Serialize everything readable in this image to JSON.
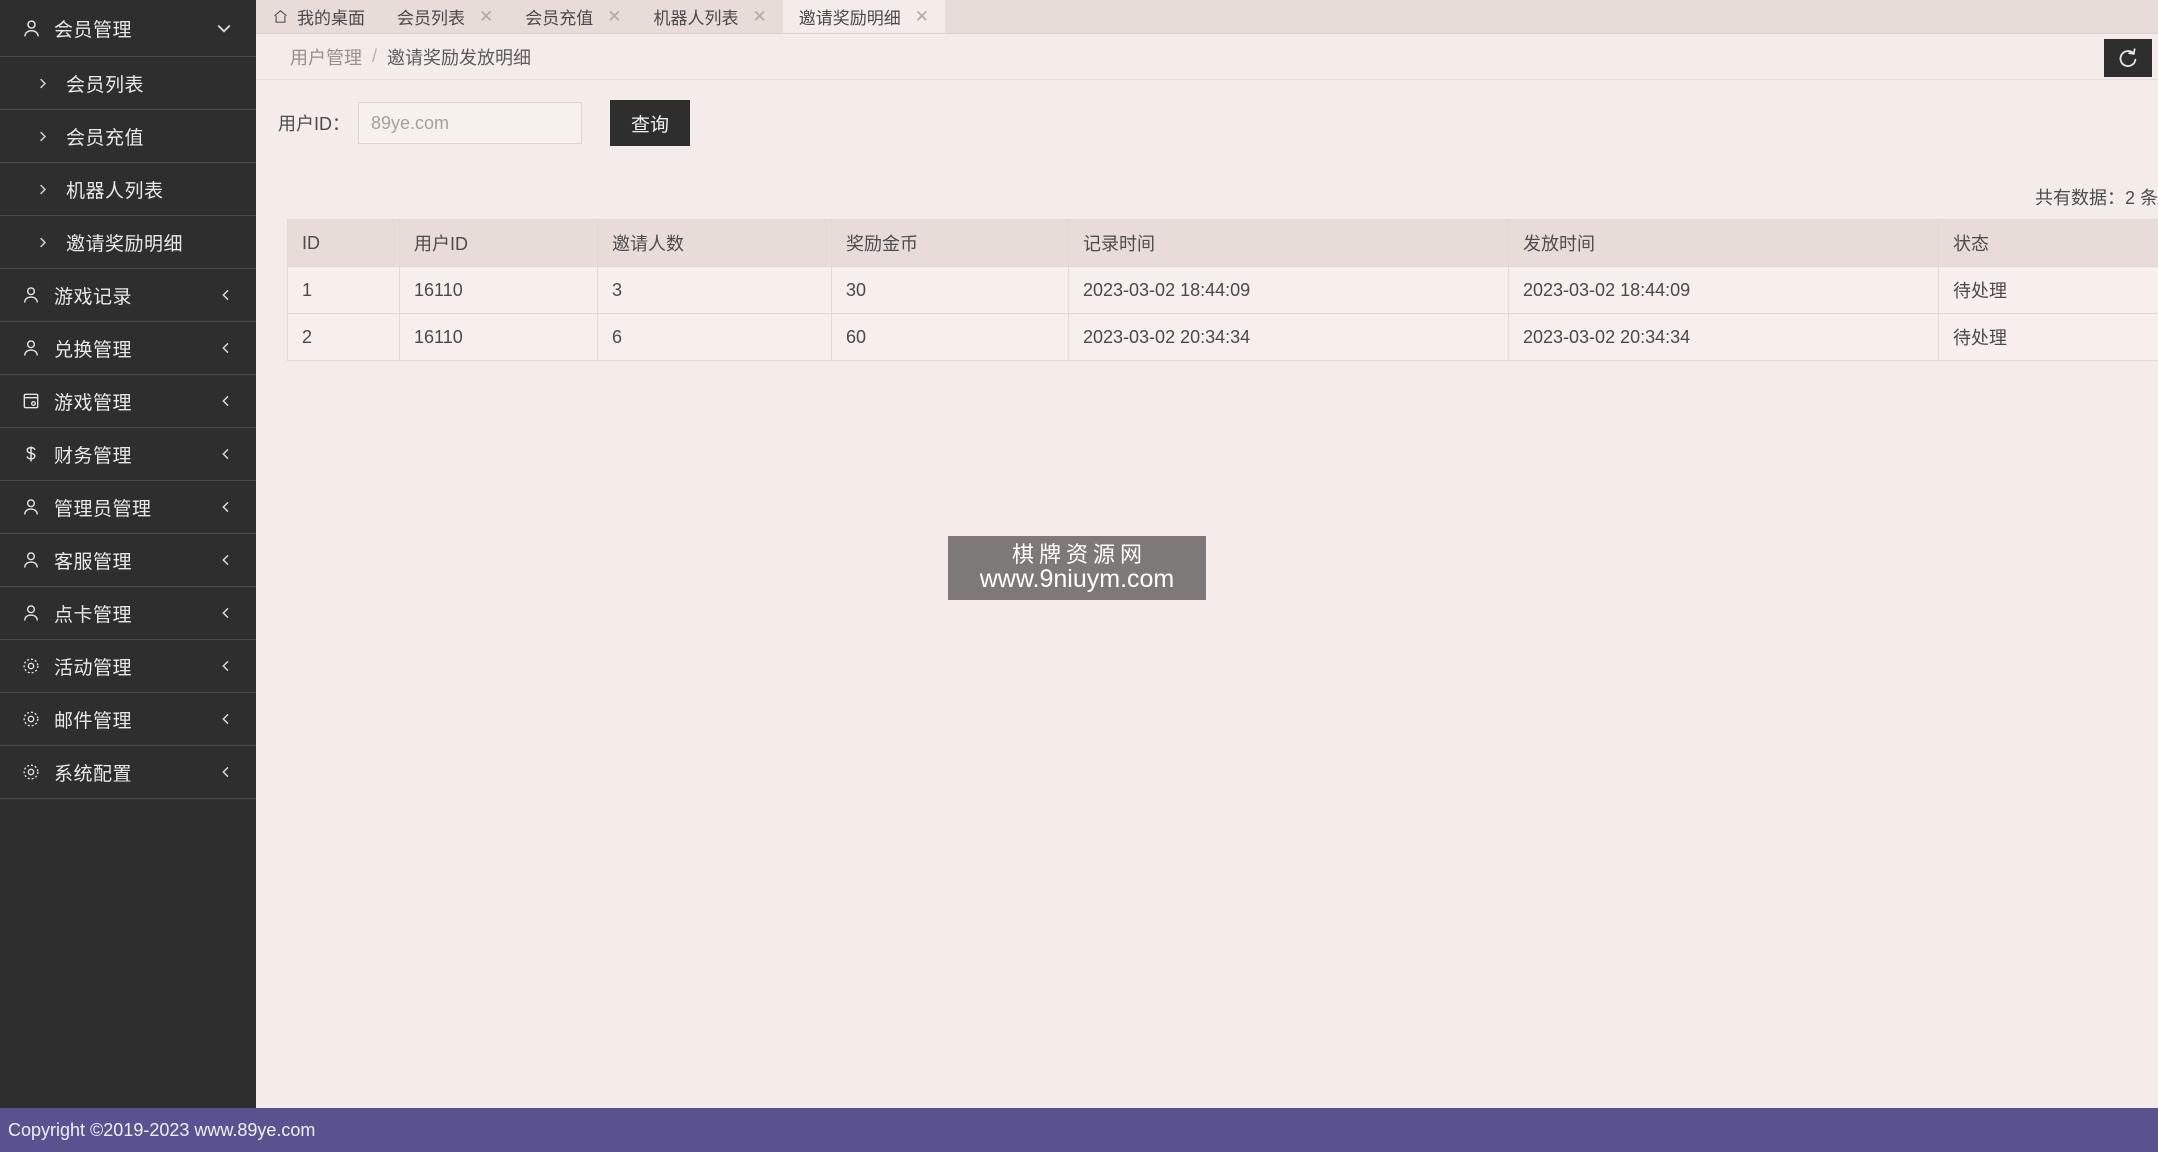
{
  "sidebar": {
    "group": {
      "label": "会员管理",
      "icon": "user-icon",
      "caret": "chevron-down-icon",
      "children": [
        {
          "label": "会员列表",
          "icon": "chevron-right-icon"
        },
        {
          "label": "会员充值",
          "icon": "chevron-right-icon"
        },
        {
          "label": "机器人列表",
          "icon": "chevron-right-icon"
        },
        {
          "label": "邀请奖励明细",
          "icon": "chevron-right-icon"
        }
      ]
    },
    "items": [
      {
        "label": "游戏记录",
        "icon": "user-icon",
        "caret": "chevron-left-icon"
      },
      {
        "label": "兑换管理",
        "icon": "user-icon",
        "caret": "chevron-left-icon"
      },
      {
        "label": "游戏管理",
        "icon": "card-icon",
        "caret": "chevron-left-icon"
      },
      {
        "label": "财务管理",
        "icon": "dollar-icon",
        "caret": "chevron-left-icon"
      },
      {
        "label": "管理员管理",
        "icon": "user-icon",
        "caret": "chevron-left-icon"
      },
      {
        "label": "客服管理",
        "icon": "user-icon",
        "caret": "chevron-left-icon"
      },
      {
        "label": "点卡管理",
        "icon": "user-icon",
        "caret": "chevron-left-icon"
      },
      {
        "label": "活动管理",
        "icon": "gear-icon",
        "caret": "chevron-left-icon"
      },
      {
        "label": "邮件管理",
        "icon": "gear-icon",
        "caret": "chevron-left-icon"
      },
      {
        "label": "系统配置",
        "icon": "gear-icon",
        "caret": "chevron-left-icon"
      }
    ]
  },
  "tabs": [
    {
      "label": "我的桌面",
      "icon": "home-icon",
      "closable": false,
      "active": false
    },
    {
      "label": "会员列表",
      "closable": true,
      "active": false
    },
    {
      "label": "会员充值",
      "closable": true,
      "active": false
    },
    {
      "label": "机器人列表",
      "closable": true,
      "active": false
    },
    {
      "label": "邀请奖励明细",
      "closable": true,
      "active": true
    }
  ],
  "breadcrumb": {
    "parent": "用户管理",
    "separator": "/",
    "current": "邀请奖励发放明细",
    "refresh_icon": "refresh-icon"
  },
  "filter": {
    "label": "用户ID：",
    "input_value": "",
    "input_placeholder": "89ye.com",
    "query_label": "查询"
  },
  "summary": {
    "count_text": "共有数据：2 条"
  },
  "table": {
    "columns": [
      "ID",
      "用户ID",
      "邀请人数",
      "奖励金币",
      "记录时间",
      "发放时间",
      "状态"
    ],
    "rows": [
      [
        "1",
        "16110",
        "3",
        "30",
        "2023-03-02 18:44:09",
        "2023-03-02 18:44:09",
        "待处理"
      ],
      [
        "2",
        "16110",
        "6",
        "60",
        "2023-03-02 20:34:34",
        "2023-03-02 20:34:34",
        "待处理"
      ]
    ]
  },
  "watermark": {
    "title": "棋牌资源网",
    "url": "www.9niuym.com"
  },
  "footer": {
    "text": "Copyright ©2019-2023 www.89ye.com"
  },
  "colors": {
    "sidebar_bg": "#2e2e2e",
    "page_bg": "#f4ece8",
    "tab_bar_bg": "#e7dcd8",
    "accent_dark": "#2e2e2e",
    "footer_bg": "#5a5191",
    "table_header_bg": "#e7dcd8",
    "table_row_bg": "#f6efeb"
  }
}
